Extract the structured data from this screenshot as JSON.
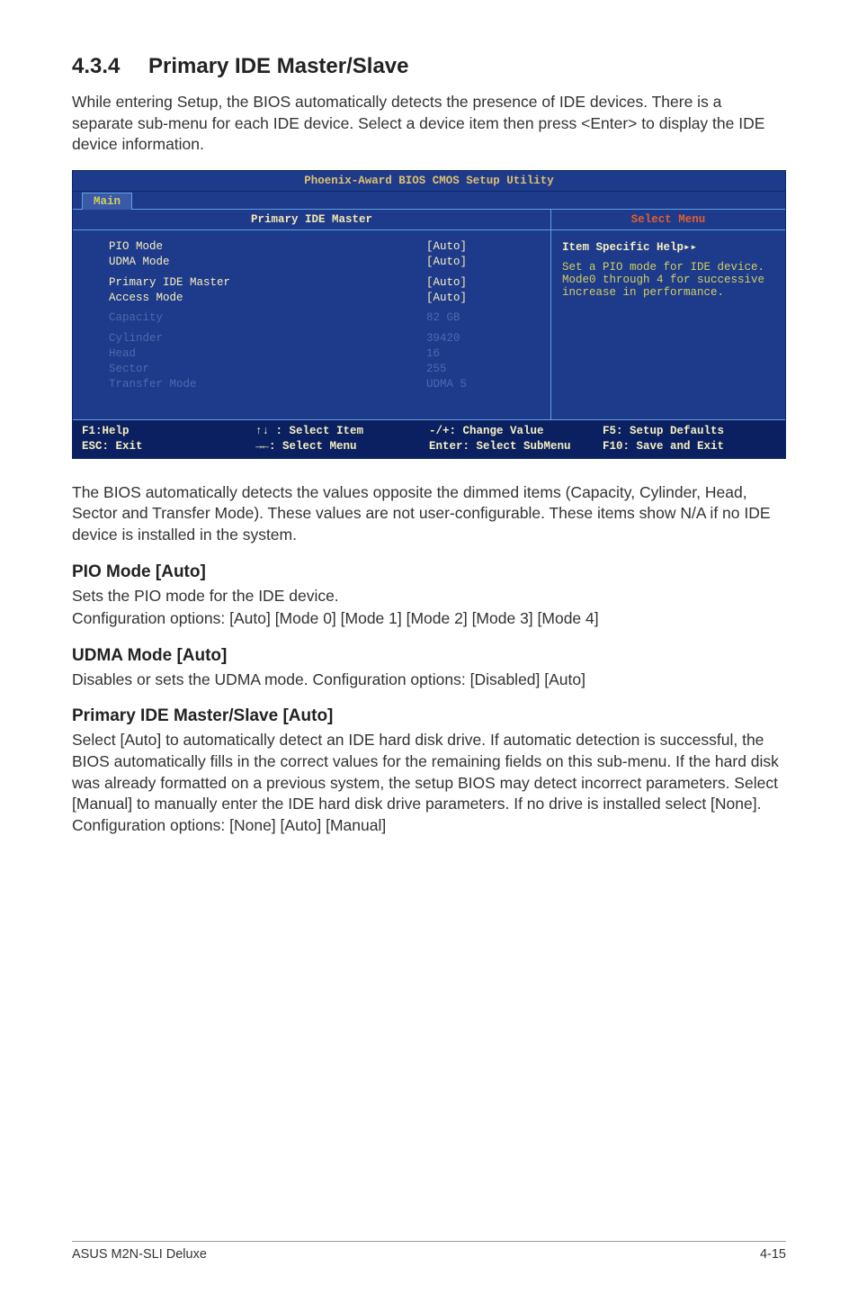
{
  "section": {
    "number": "4.3.4",
    "title": "Primary IDE Master/Slave"
  },
  "intro": "While entering Setup, the BIOS automatically detects the presence of IDE devices. There is a separate sub-menu for each IDE device. Select a device item then press <Enter> to display the IDE device information.",
  "bios": {
    "title": "Phoenix-Award BIOS CMOS Setup Utility",
    "tab": "Main",
    "left_header": "Primary IDE Master",
    "right_header": "Select Menu",
    "rows": {
      "pio_mode": {
        "label": "PIO Mode",
        "value": "[Auto]"
      },
      "udma_mode": {
        "label": "UDMA Mode",
        "value": "[Auto]"
      },
      "primary_master": {
        "label": "Primary IDE Master",
        "value": "[Auto]"
      },
      "access_mode": {
        "label": "Access Mode",
        "value": "[Auto]"
      },
      "capacity": {
        "label": "Capacity",
        "value": "82 GB"
      },
      "cylinder": {
        "label": "Cylinder",
        "value": "39420"
      },
      "head": {
        "label": "Head",
        "value": "16"
      },
      "sector": {
        "label": "Sector",
        "value": "255"
      },
      "transfer_mode": {
        "label": "Transfer Mode",
        "value": "UDMA 5"
      }
    },
    "help": {
      "title": "Item Specific Help",
      "body": "Set a PIO mode for IDE device. Mode0 through 4 for successive increase in performance."
    },
    "footer": {
      "f1": "F1:Help",
      "updown": "↑↓ : Select Item",
      "plusminus": "-/+: Change Value",
      "f5": "F5: Setup Defaults",
      "esc": "ESC: Exit",
      "leftright": "→←: Select Menu",
      "enter": "Enter: Select SubMenu",
      "f10": "F10: Save and Exit"
    }
  },
  "after_bios": "The BIOS automatically detects the values opposite the dimmed items (Capacity, Cylinder,  Head, Sector and Transfer Mode). These values are not user-configurable. These items show N/A if no IDE device is installed in the system.",
  "subsections": {
    "pio": {
      "heading": "PIO Mode [Auto]",
      "line1": "Sets the PIO mode for the IDE device.",
      "line2": "Configuration options: [Auto] [Mode 0] [Mode 1] [Mode 2] [Mode 3] [Mode 4]"
    },
    "udma": {
      "heading": "UDMA Mode [Auto]",
      "line1": "Disables or sets the UDMA mode. Configuration options: [Disabled] [Auto]"
    },
    "primary": {
      "heading": "Primary IDE Master/Slave [Auto]",
      "body": "Select [Auto] to automatically detect an IDE hard disk drive. If automatic detection is successful, the BIOS automatically fills in the correct values for the remaining fields on this sub-menu. If the hard disk was already formatted on a previous system, the setup BIOS may detect incorrect parameters. Select [Manual] to manually enter the IDE hard disk drive parameters. If no drive is installed select [None]. Configuration options: [None] [Auto] [Manual]"
    }
  },
  "page_footer": {
    "product": "ASUS M2N-SLI Deluxe",
    "page": "4-15"
  }
}
